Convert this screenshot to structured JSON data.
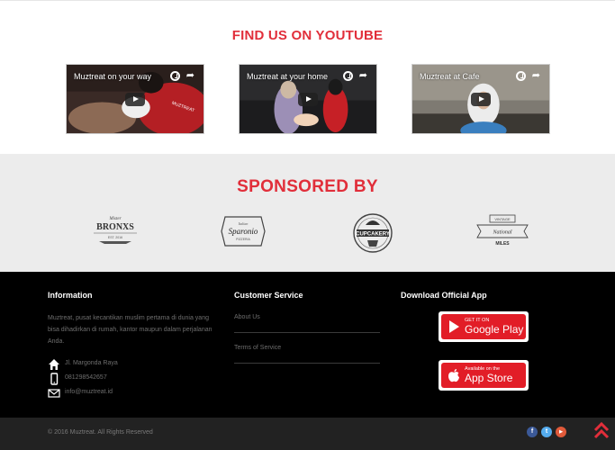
{
  "youtube": {
    "title": "FIND US ON YOUTUBE",
    "videos": [
      {
        "title": "Muztreat on your way",
        "shirt_text": "MUZTREAT"
      },
      {
        "title": "Muztreat at your home"
      },
      {
        "title": "Muztreat at Cafe"
      }
    ]
  },
  "sponsors": {
    "title": "SPONSORED BY",
    "logos": [
      {
        "top": "Mister",
        "main": "BRONXS",
        "sub": "EST. 2016"
      },
      {
        "top": "Italian",
        "main": "Sparonio",
        "sub": "PIZZERIA"
      },
      {
        "main": "CUPCAKERY"
      },
      {
        "top": "VINTAGE",
        "main": "National",
        "sub": "MILES"
      }
    ]
  },
  "footer": {
    "information": {
      "heading": "Information",
      "description": "Muztreat, pusat kecantikan muslim pertama di dunia yang bisa dihadirkan di rumah, kantor maupun dalam perjalanan Anda.",
      "address": "Jl. Margonda Raya",
      "phone": "081298542657",
      "email": "info@muztreat.id"
    },
    "customer_service": {
      "heading": "Customer Service",
      "links": [
        "About Us",
        "Terms of Service"
      ]
    },
    "app": {
      "heading": "Download Official App",
      "google_play": {
        "small": "GET IT ON",
        "big": "Google Play"
      },
      "app_store": {
        "small": "Available on the",
        "big": "App Store"
      }
    }
  },
  "bottom": {
    "copyright": "© 2016 Muztreat. All Rights Reserved",
    "social": [
      {
        "icon": "facebook-icon",
        "glyph": "f",
        "color": "#3b5998"
      },
      {
        "icon": "twitter-icon",
        "glyph": "t",
        "color": "#55acee"
      },
      {
        "icon": "youtube-icon",
        "glyph": "▶",
        "color": "#e05a3a"
      }
    ]
  },
  "colors": {
    "accent": "#e12e3a",
    "footer_bg": "#000000",
    "bottom_bg": "#222222",
    "sponsor_bg": "#ececec"
  }
}
